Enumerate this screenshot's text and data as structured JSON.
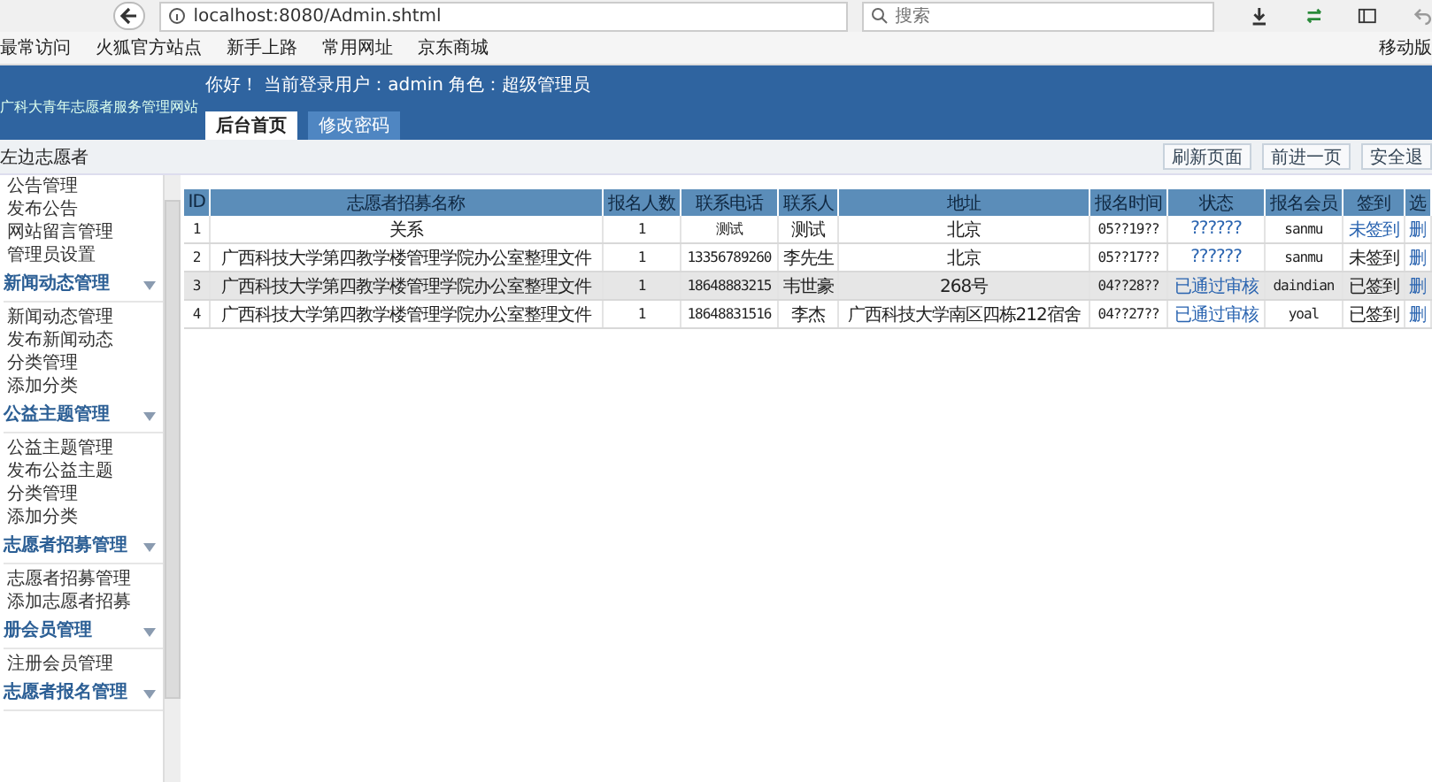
{
  "browser": {
    "url": "localhost:8080/Admin.shtml",
    "search_placeholder": "搜索",
    "bookmarks": [
      "最常访问",
      "火狐官方站点",
      "新手上路",
      "常用网址",
      "京东商城"
    ],
    "mobile_bookmarks": "移动版"
  },
  "header": {
    "site_title": "广科大青年志愿者服务管理网站",
    "welcome": "你好！ 当前登录用户：admin 角色：超级管理员",
    "tabs": [
      {
        "label": "后台首页",
        "selected": true
      },
      {
        "label": "修改密码",
        "selected": false
      }
    ]
  },
  "breadcrumb": "左边志愿者",
  "actions": [
    "刷新页面",
    "前进一页",
    "安全退"
  ],
  "sidebar": {
    "groups": [
      {
        "children": [
          "公告管理",
          "发布公告",
          "网站留言管理",
          "管理员设置"
        ]
      },
      {
        "title": "新闻动态管理",
        "children": [
          "新闻动态管理",
          "发布新闻动态",
          "分类管理",
          "添加分类"
        ]
      },
      {
        "title": "公益主题管理",
        "children": [
          "公益主题管理",
          "发布公益主题",
          "分类管理",
          "添加分类"
        ]
      },
      {
        "title": "志愿者招募管理",
        "children": [
          "志愿者招募管理",
          "添加志愿者招募"
        ]
      },
      {
        "title": "册会员管理",
        "children": [
          "注册会员管理"
        ]
      },
      {
        "title": "志愿者报名管理"
      }
    ]
  },
  "table": {
    "columns": [
      "ID",
      "志愿者招募名称",
      "报名人数",
      "联系电话",
      "联系人",
      "地址",
      "报名时间",
      "状态",
      "报名会员",
      "签到",
      "选"
    ],
    "rows": [
      {
        "id": "1",
        "name": "关系",
        "count": "1",
        "phone": "测试",
        "contact": "测试",
        "address": "北京",
        "time": "05??19??",
        "status": "??????",
        "member": "sanmu",
        "sign_in": "未签到",
        "sign_in_link": true,
        "action": "删",
        "selected": false
      },
      {
        "id": "2",
        "name": "广西科技大学第四教学楼管理学院办公室整理文件",
        "count": "1",
        "phone": "13356789260",
        "contact": "李先生",
        "address": "北京",
        "time": "05??17??",
        "status": "??????",
        "member": "sanmu",
        "sign_in": "未签到",
        "sign_in_link": false,
        "action": "删",
        "selected": false
      },
      {
        "id": "3",
        "name": "广西科技大学第四教学楼管理学院办公室整理文件",
        "count": "1",
        "phone": "18648883215",
        "contact": "韦世豪",
        "address": "268号",
        "time": "04??28??",
        "status": "已通过审核",
        "member": "daindian",
        "sign_in": "已签到",
        "sign_in_link": false,
        "action": "删",
        "selected": true
      },
      {
        "id": "4",
        "name": "广西科技大学第四教学楼管理学院办公室整理文件",
        "count": "1",
        "phone": "18648831516",
        "contact": "李杰",
        "address": "广西科技大学南区四栋212宿舍",
        "time": "04??27??",
        "status": "已通过审核",
        "member": "yoal",
        "sign_in": "已签到",
        "sign_in_link": false,
        "action": "删",
        "selected": false
      }
    ]
  }
}
